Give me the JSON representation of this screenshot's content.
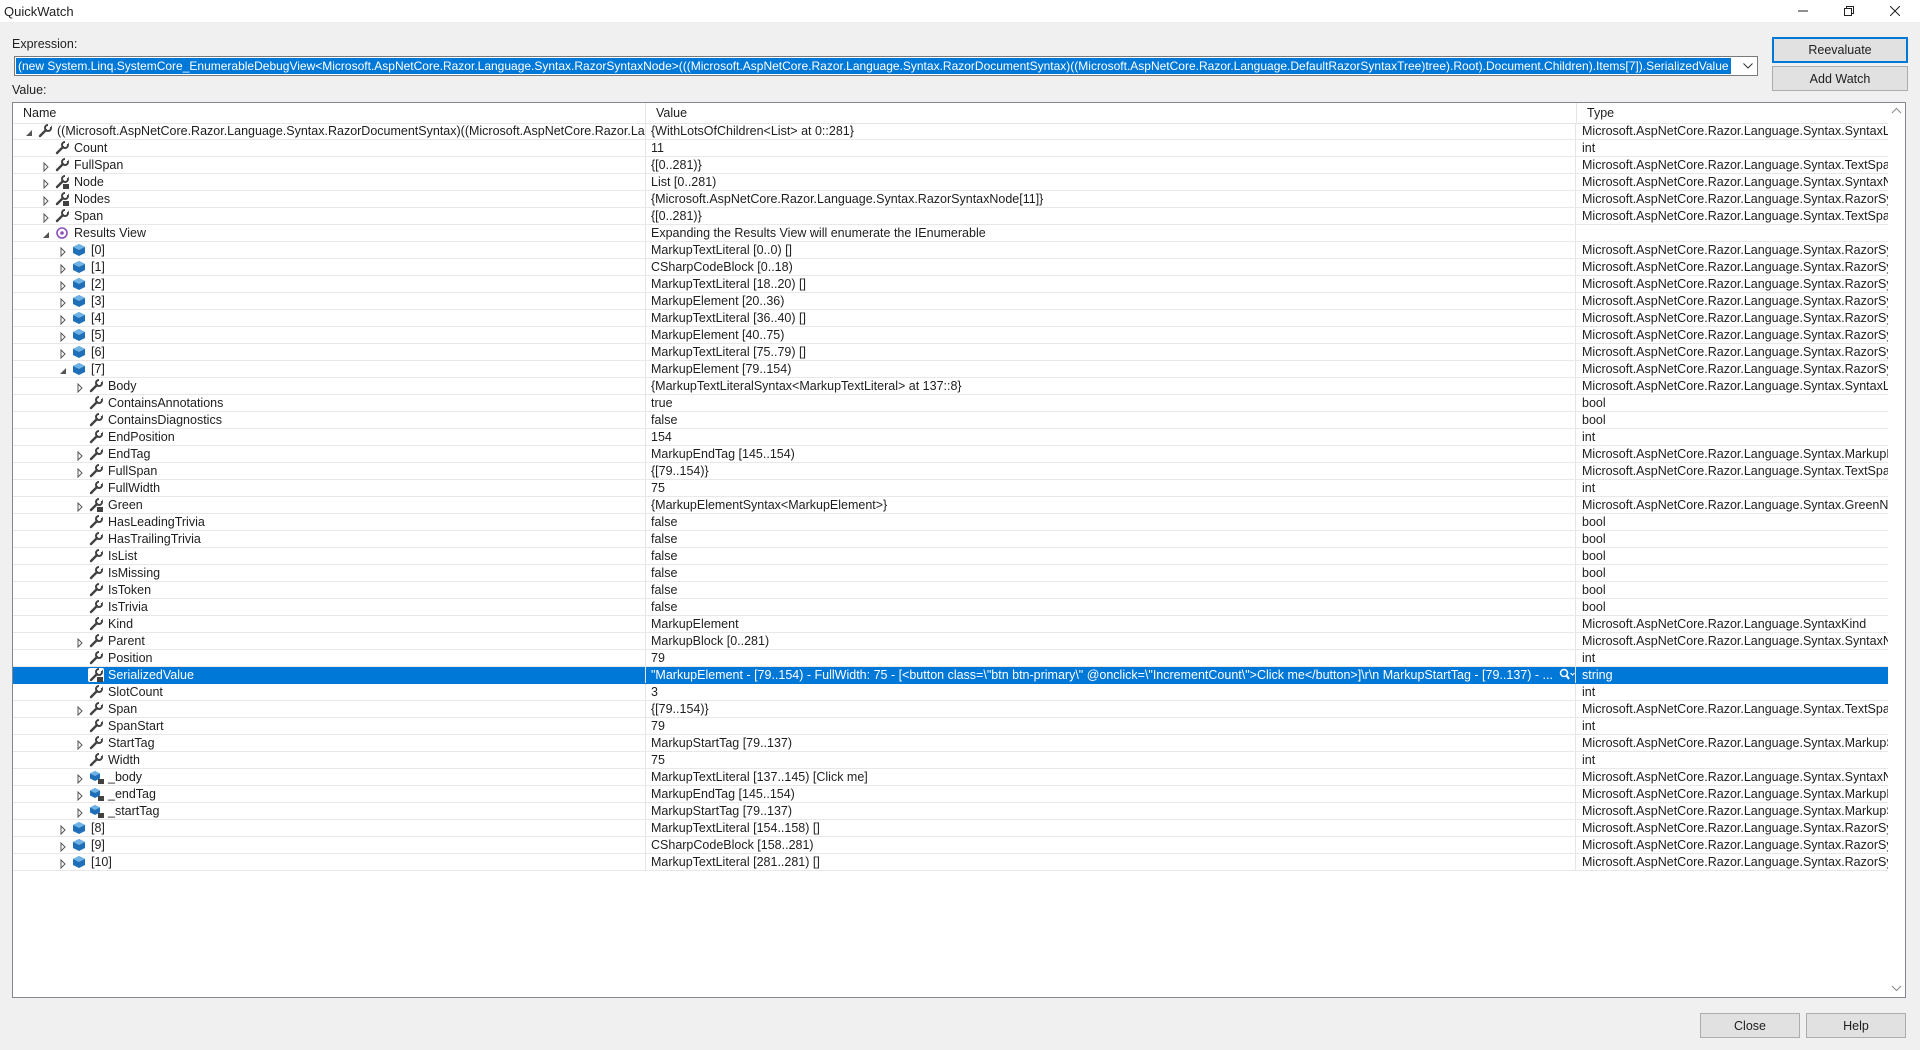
{
  "window": {
    "title": "QuickWatch"
  },
  "labels": {
    "expression": "Expression:",
    "value": "Value:"
  },
  "expression": {
    "text": "(new System.Linq.SystemCore_EnumerableDebugView<Microsoft.AspNetCore.Razor.Language.Syntax.RazorSyntaxNode>(((Microsoft.AspNetCore.Razor.Language.Syntax.RazorDocumentSyntax)((Microsoft.AspNetCore.Razor.Language.DefaultRazorSyntaxTree)tree).Root).Document.Children).Items[7]).SerializedValue"
  },
  "buttons": {
    "reevaluate": "Reevaluate",
    "add_watch": "Add Watch",
    "close": "Close",
    "help": "Help"
  },
  "columns": {
    "name": "Name",
    "value": "Value",
    "type": "Type"
  },
  "rows": [
    {
      "level": 0,
      "exp": "open",
      "icon": "wrench",
      "name": "((Microsoft.AspNetCore.Razor.Language.Syntax.RazorDocumentSyntax)((Microsoft.AspNetCore.Razor.Langu...",
      "value": "{WithLotsOfChildren<List> at 0::281}",
      "type": "Microsoft.AspNetCore.Razor.Language.Syntax.SyntaxList..."
    },
    {
      "level": 1,
      "exp": "none",
      "icon": "wrench",
      "name": "Count",
      "value": "11",
      "type": "int"
    },
    {
      "level": 1,
      "exp": "closed",
      "icon": "wrench",
      "name": "FullSpan",
      "value": "{[0..281)}",
      "type": "Microsoft.AspNetCore.Razor.Language.Syntax.TextSpan"
    },
    {
      "level": 1,
      "exp": "closed",
      "icon": "wrench-lock",
      "name": "Node",
      "value": "List [0..281)",
      "type": "Microsoft.AspNetCore.Razor.Language.Syntax.SyntaxNo..."
    },
    {
      "level": 1,
      "exp": "closed",
      "icon": "wrench-lock",
      "name": "Nodes",
      "value": "{Microsoft.AspNetCore.Razor.Language.Syntax.RazorSyntaxNode[11]}",
      "type": "Microsoft.AspNetCore.Razor.Language.Syntax.RazorSynt..."
    },
    {
      "level": 1,
      "exp": "closed",
      "icon": "wrench",
      "name": "Span",
      "value": "{[0..281)}",
      "type": "Microsoft.AspNetCore.Razor.Language.Syntax.TextSpan"
    },
    {
      "level": 1,
      "exp": "open",
      "icon": "results",
      "name": "Results View",
      "value": "Expanding the Results View will enumerate the IEnumerable",
      "type": ""
    },
    {
      "level": 2,
      "exp": "closed",
      "icon": "cube",
      "name": "[0]",
      "value": "MarkupTextLiteral [0..0) []",
      "type": "Microsoft.AspNetCore.Razor.Language.Syntax.RazorSynt..."
    },
    {
      "level": 2,
      "exp": "closed",
      "icon": "cube",
      "name": "[1]",
      "value": "CSharpCodeBlock [0..18)",
      "type": "Microsoft.AspNetCore.Razor.Language.Syntax.RazorSynt..."
    },
    {
      "level": 2,
      "exp": "closed",
      "icon": "cube",
      "name": "[2]",
      "value": "MarkupTextLiteral [18..20) []",
      "type": "Microsoft.AspNetCore.Razor.Language.Syntax.RazorSynt..."
    },
    {
      "level": 2,
      "exp": "closed",
      "icon": "cube",
      "name": "[3]",
      "value": "MarkupElement [20..36)",
      "type": "Microsoft.AspNetCore.Razor.Language.Syntax.RazorSynt..."
    },
    {
      "level": 2,
      "exp": "closed",
      "icon": "cube",
      "name": "[4]",
      "value": "MarkupTextLiteral [36..40) []",
      "type": "Microsoft.AspNetCore.Razor.Language.Syntax.RazorSynt..."
    },
    {
      "level": 2,
      "exp": "closed",
      "icon": "cube",
      "name": "[5]",
      "value": "MarkupElement [40..75)",
      "type": "Microsoft.AspNetCore.Razor.Language.Syntax.RazorSynt..."
    },
    {
      "level": 2,
      "exp": "closed",
      "icon": "cube",
      "name": "[6]",
      "value": "MarkupTextLiteral [75..79) []",
      "type": "Microsoft.AspNetCore.Razor.Language.Syntax.RazorSynt..."
    },
    {
      "level": 2,
      "exp": "open",
      "icon": "cube",
      "name": "[7]",
      "value": "MarkupElement [79..154)",
      "type": "Microsoft.AspNetCore.Razor.Language.Syntax.RazorSynt..."
    },
    {
      "level": 3,
      "exp": "closed",
      "icon": "wrench",
      "name": "Body",
      "value": "{MarkupTextLiteralSyntax<MarkupTextLiteral> at 137::8}",
      "type": "Microsoft.AspNetCore.Razor.Language.Syntax.SyntaxList..."
    },
    {
      "level": 3,
      "exp": "none",
      "icon": "wrench",
      "name": "ContainsAnnotations",
      "value": "true",
      "type": "bool"
    },
    {
      "level": 3,
      "exp": "none",
      "icon": "wrench",
      "name": "ContainsDiagnostics",
      "value": "false",
      "type": "bool"
    },
    {
      "level": 3,
      "exp": "none",
      "icon": "wrench",
      "name": "EndPosition",
      "value": "154",
      "type": "int"
    },
    {
      "level": 3,
      "exp": "closed",
      "icon": "wrench",
      "name": "EndTag",
      "value": "MarkupEndTag [145..154)",
      "type": "Microsoft.AspNetCore.Razor.Language.Syntax.MarkupE..."
    },
    {
      "level": 3,
      "exp": "closed",
      "icon": "wrench",
      "name": "FullSpan",
      "value": "{[79..154)}",
      "type": "Microsoft.AspNetCore.Razor.Language.Syntax.TextSpan"
    },
    {
      "level": 3,
      "exp": "none",
      "icon": "wrench",
      "name": "FullWidth",
      "value": "75",
      "type": "int"
    },
    {
      "level": 3,
      "exp": "closed",
      "icon": "wrench-lock",
      "name": "Green",
      "value": "{MarkupElementSyntax<MarkupElement>}",
      "type": "Microsoft.AspNetCore.Razor.Language.Syntax.GreenNo..."
    },
    {
      "level": 3,
      "exp": "none",
      "icon": "wrench",
      "name": "HasLeadingTrivia",
      "value": "false",
      "type": "bool"
    },
    {
      "level": 3,
      "exp": "none",
      "icon": "wrench",
      "name": "HasTrailingTrivia",
      "value": "false",
      "type": "bool"
    },
    {
      "level": 3,
      "exp": "none",
      "icon": "wrench",
      "name": "IsList",
      "value": "false",
      "type": "bool"
    },
    {
      "level": 3,
      "exp": "none",
      "icon": "wrench",
      "name": "IsMissing",
      "value": "false",
      "type": "bool"
    },
    {
      "level": 3,
      "exp": "none",
      "icon": "wrench",
      "name": "IsToken",
      "value": "false",
      "type": "bool"
    },
    {
      "level": 3,
      "exp": "none",
      "icon": "wrench",
      "name": "IsTrivia",
      "value": "false",
      "type": "bool"
    },
    {
      "level": 3,
      "exp": "none",
      "icon": "wrench",
      "name": "Kind",
      "value": "MarkupElement",
      "type": "Microsoft.AspNetCore.Razor.Language.SyntaxKind"
    },
    {
      "level": 3,
      "exp": "closed",
      "icon": "wrench",
      "name": "Parent",
      "value": "MarkupBlock [0..281)",
      "type": "Microsoft.AspNetCore.Razor.Language.Syntax.SyntaxNo..."
    },
    {
      "level": 3,
      "exp": "none",
      "icon": "wrench",
      "name": "Position",
      "value": "79",
      "type": "int"
    },
    {
      "level": 3,
      "exp": "none",
      "icon": "wrench-lock",
      "name": "SerializedValue",
      "value": "\"MarkupElement - [79..154) - FullWidth: 75 - [<button class=\\\"btn btn-primary\\\" @onclick=\\\"IncrementCount\\\">Click me</button>]\\r\\n    MarkupStartTag - [79..137) - ...",
      "type": "string",
      "selected": true
    },
    {
      "level": 3,
      "exp": "none",
      "icon": "wrench",
      "name": "SlotCount",
      "value": "3",
      "type": "int"
    },
    {
      "level": 3,
      "exp": "closed",
      "icon": "wrench",
      "name": "Span",
      "value": "{[79..154)}",
      "type": "Microsoft.AspNetCore.Razor.Language.Syntax.TextSpan"
    },
    {
      "level": 3,
      "exp": "none",
      "icon": "wrench",
      "name": "SpanStart",
      "value": "79",
      "type": "int"
    },
    {
      "level": 3,
      "exp": "closed",
      "icon": "wrench",
      "name": "StartTag",
      "value": "MarkupStartTag [79..137)",
      "type": "Microsoft.AspNetCore.Razor.Language.Syntax.MarkupSt..."
    },
    {
      "level": 3,
      "exp": "none",
      "icon": "wrench",
      "name": "Width",
      "value": "75",
      "type": "int"
    },
    {
      "level": 3,
      "exp": "closed",
      "icon": "field-lock",
      "name": "_body",
      "value": "MarkupTextLiteral [137..145) [Click me]",
      "type": "Microsoft.AspNetCore.Razor.Language.Syntax.SyntaxNo..."
    },
    {
      "level": 3,
      "exp": "closed",
      "icon": "field-lock",
      "name": "_endTag",
      "value": "MarkupEndTag [145..154)",
      "type": "Microsoft.AspNetCore.Razor.Language.Syntax.MarkupE..."
    },
    {
      "level": 3,
      "exp": "closed",
      "icon": "field-lock",
      "name": "_startTag",
      "value": "MarkupStartTag [79..137)",
      "type": "Microsoft.AspNetCore.Razor.Language.Syntax.MarkupSt..."
    },
    {
      "level": 2,
      "exp": "closed",
      "icon": "cube",
      "name": "[8]",
      "value": "MarkupTextLiteral [154..158) []",
      "type": "Microsoft.AspNetCore.Razor.Language.Syntax.RazorSynt..."
    },
    {
      "level": 2,
      "exp": "closed",
      "icon": "cube",
      "name": "[9]",
      "value": "CSharpCodeBlock [158..281)",
      "type": "Microsoft.AspNetCore.Razor.Language.Syntax.RazorSynt..."
    },
    {
      "level": 2,
      "exp": "closed",
      "icon": "cube",
      "name": "[10]",
      "value": "MarkupTextLiteral [281..281) []",
      "type": "Microsoft.AspNetCore.Razor.Language.Syntax.RazorSynt..."
    }
  ]
}
